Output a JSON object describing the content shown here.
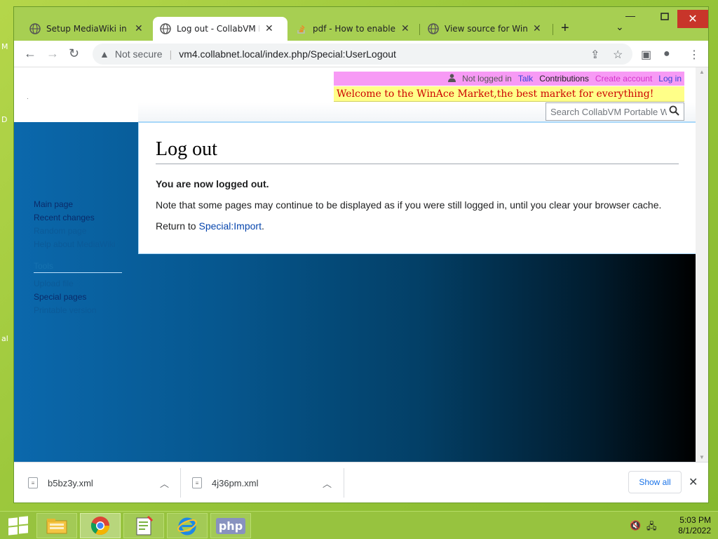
{
  "desktop": {
    "glyphs": [
      "M",
      "D",
      "al"
    ]
  },
  "browser": {
    "tabs": [
      {
        "title": "Setup MediaWiki in Col",
        "icon": "globe-icon",
        "active": false
      },
      {
        "title": "Log out - CollabVM Por",
        "icon": "globe-icon",
        "active": true
      },
      {
        "title": "pdf - How to enable ml",
        "icon": "stackoverflow-icon",
        "active": false
      },
      {
        "title": "View source for WinAc",
        "icon": "globe-icon",
        "active": false
      }
    ],
    "new_tab_glyph": "+",
    "address": {
      "security_label": "Not secure",
      "url": "vm4.collabnet.local/index.php/Special:UserLogout"
    }
  },
  "page": {
    "personal_tools": {
      "status": "Not logged in",
      "talk": "Talk",
      "contributions": "Contributions",
      "create_account": "Create account",
      "login": "Log in"
    },
    "banner": "Welcome to the WinAce Market,the best market for everything!",
    "search_placeholder": "Search CollabVM Portable W",
    "sidebar": {
      "nav": [
        "Main page",
        "Recent changes",
        "Random page",
        "Help about MediaWiki"
      ],
      "tools_heading": "Tools",
      "tools": [
        "Upload file",
        "Special pages",
        "Printable version"
      ]
    },
    "heading": "Log out",
    "lead": "You are now logged out.",
    "note": "Note that some pages may continue to be displayed as if you were still logged in, until you clear your browser cache.",
    "return_prefix": "Return to ",
    "return_link": "Special:Import",
    "return_suffix": "."
  },
  "downloads": {
    "items": [
      {
        "name": "b5bz3y.xml"
      },
      {
        "name": "4j36pm.xml"
      }
    ],
    "show_all": "Show all"
  },
  "taskbar": {
    "apps": [
      "file-explorer-icon",
      "chrome-icon",
      "notepad-plus-plus-icon",
      "internet-explorer-icon",
      "php-icon"
    ],
    "php_label": "php",
    "time": "5:03 PM",
    "date": "8/1/2022"
  }
}
